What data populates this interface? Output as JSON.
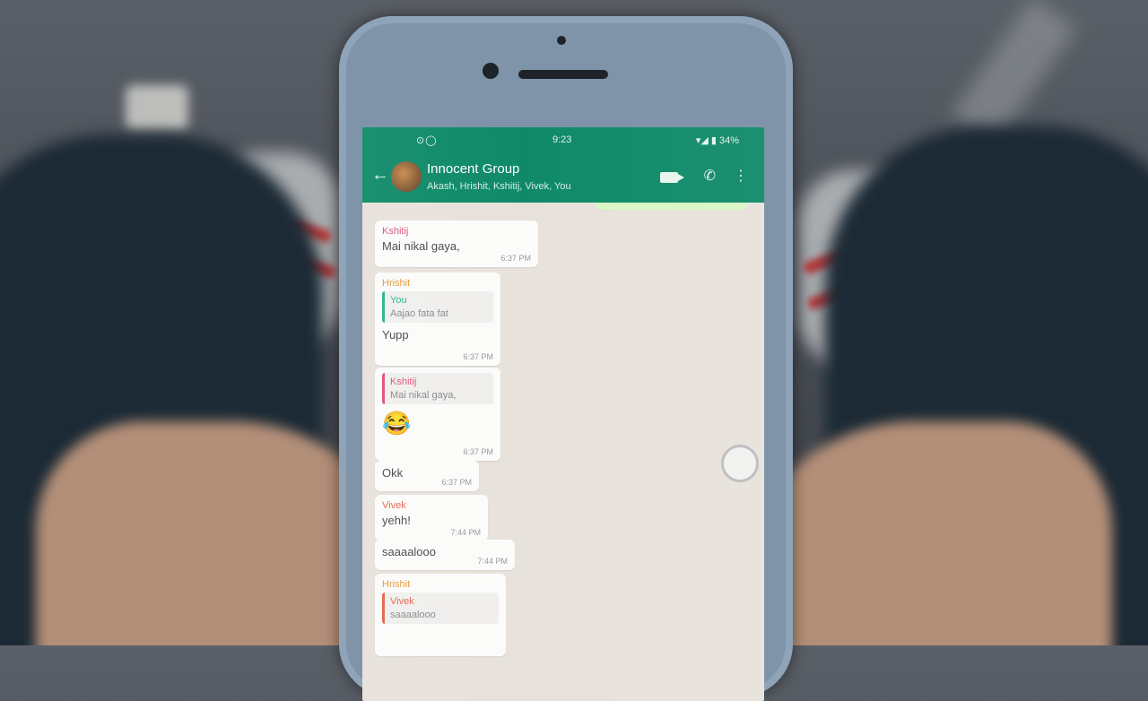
{
  "status_bar": {
    "left_icons": "⊙◯",
    "time": "9:23",
    "battery": "34%"
  },
  "header": {
    "title": "Innocent Group",
    "subtitle": "Akash, Hrishit, Kshitij, Vivek, You"
  },
  "messages": [
    {
      "sender": "Kshitij",
      "text": "Mai nikal gaya,",
      "time": "6:37 PM"
    },
    {
      "sender": "Hrishit",
      "quote_name": "You",
      "quote_text": "Aajao fata fat",
      "text": "Yupp",
      "time": "6:37 PM"
    },
    {
      "quote_name": "Kshitij",
      "quote_text": "Mai nikal gaya,",
      "emoji": "😂",
      "time": "6:37 PM"
    },
    {
      "text": "Okk",
      "time": "6:37 PM"
    },
    {
      "sender": "Vivek",
      "text": "yehh!",
      "time": "7:44 PM"
    },
    {
      "text": "saaaalooo",
      "time": "7:44 PM"
    },
    {
      "sender": "Hrishit",
      "quote_name": "Vivek",
      "quote_text": "saaaalooo"
    }
  ],
  "colors": {
    "header": "#0f8a69",
    "chat_bg": "#e8e2dc",
    "kshitij": "#e0527c",
    "hrishit": "#e59a3a",
    "vivek": "#e5674c",
    "you": "#2cb28f"
  },
  "icons": [
    "back-arrow-icon",
    "video-call-icon",
    "phone-call-icon",
    "more-menu-icon",
    "scroll-down-icon"
  ]
}
